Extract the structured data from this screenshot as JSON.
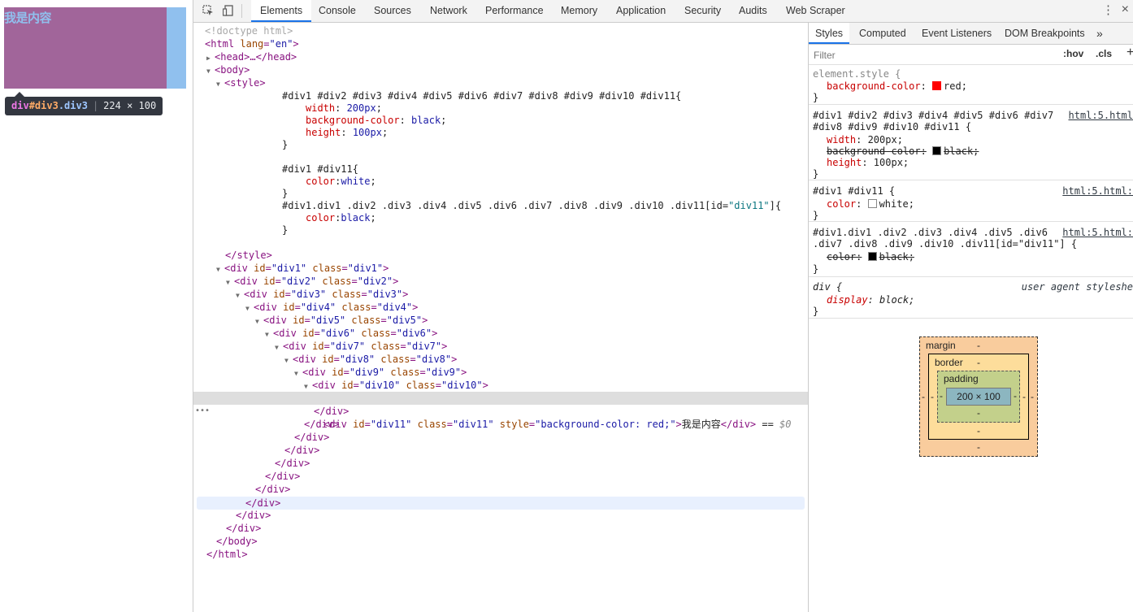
{
  "preview": {
    "content_text": "我是内容",
    "tooltip": {
      "tag": "div",
      "id": "#div3",
      "classes": ".div3",
      "size": "224 × 100"
    }
  },
  "toolbar": {
    "tabs": [
      "Elements",
      "Console",
      "Sources",
      "Network",
      "Performance",
      "Memory",
      "Application",
      "Security",
      "Audits",
      "Web Scraper"
    ],
    "active_tab": "Elements",
    "inspect_icon": "inspect-element-icon",
    "device_icon": "device-toolbar-icon",
    "menu_icon": "more-vertical-icon",
    "close_icon": "close-icon"
  },
  "dom": {
    "doctype": "<!doctype html>",
    "html_open_tag": "html",
    "html_lang_attr": "lang",
    "html_lang_val": "\"en\"",
    "head_collapsed": "<head>…</head>",
    "body_tag": "body",
    "style_tag": "style",
    "css_rule1_selector": "#div1 #div2 #div3 #div4 #div5 #div6 #div7 #div8 #div9 #div10 #div11{",
    "css_rule1_decls": [
      {
        "prop": "width",
        "val": "200px"
      },
      {
        "prop": "background-color",
        "val": "black"
      },
      {
        "prop": "height",
        "val": "100px"
      }
    ],
    "css_rule2_selector": "#div1 #div11{",
    "css_rule2_decls": [
      {
        "prop": "color",
        "val": "white"
      }
    ],
    "css_rule3_selector_pre": "#div1.div1 .div2 .div3 .div4 .div5 .div6 .div7 .div8 .div9 .div10 .div11[id=",
    "css_rule3_selector_str": "\"div11\"",
    "css_rule3_selector_post": "]{",
    "css_rule3_decls": [
      {
        "prop": "color",
        "val": "black"
      }
    ],
    "close_brace": "}",
    "style_close": "</style>",
    "divs": [
      {
        "id": "\"div1\"",
        "cls": "\"div1\""
      },
      {
        "id": "\"div2\"",
        "cls": "\"div2\""
      },
      {
        "id": "\"div3\"",
        "cls": "\"div3\""
      },
      {
        "id": "\"div4\"",
        "cls": "\"div4\""
      },
      {
        "id": "\"div5\"",
        "cls": "\"div5\""
      },
      {
        "id": "\"div6\"",
        "cls": "\"div6\""
      },
      {
        "id": "\"div7\"",
        "cls": "\"div7\""
      },
      {
        "id": "\"div8\"",
        "cls": "\"div8\""
      },
      {
        "id": "\"div9\"",
        "cls": "\"div9\""
      },
      {
        "id": "\"div10\"",
        "cls": "\"div10\""
      }
    ],
    "selected_node": {
      "id": "\"div11\"",
      "cls": "\"div11\"",
      "style": "\"background-color: red;\"",
      "text": "我是内容",
      "eq": "==",
      "var": "$0"
    },
    "div_close": "</div>",
    "body_close": "</body>",
    "html_close": "</html>"
  },
  "sidebar": {
    "tabs": [
      "Styles",
      "Computed",
      "Event Listeners",
      "DOM Breakpoints"
    ],
    "more_tabs_icon": "double-chevron-right-icon",
    "filter_placeholder": "Filter",
    "hov_label": ":hov",
    "cls_label": ".cls",
    "add_label": "+",
    "rules": {
      "element_style": {
        "selector": "element.style {",
        "prop": "background-color",
        "val": "red",
        "swatch": "#ff0000"
      },
      "rule1": {
        "selector_l1": "#div1 #div2 #div3 #div4 #div5 #div6 #div7",
        "selector_l2": "#div8 #div9 #div10 #div11 {",
        "source": "html:5.html",
        "decls": [
          "width: 200px;",
          "height: 100px;"
        ],
        "struck_prop": "background-color:",
        "struck_val": "black;",
        "swatch": "#000000"
      },
      "rule2": {
        "selector": "#div1 #div11 {",
        "source": "html:5.html:",
        "prop": "color",
        "val": "white;",
        "swatch": "#ffffff"
      },
      "rule3": {
        "selector_l1": "#div1.div1 .div2 .div3 .div4 .div5 .div6",
        "selector_l2": ".div7 .div8 .div9 .div10 .div11[id=\"div11\"] {",
        "source": "html:5.html:",
        "struck_prop": "color:",
        "struck_val": "black;",
        "swatch": "#000000"
      },
      "ua_rule": {
        "selector": "div {",
        "source": "user agent styleshe",
        "prop": "display",
        "val": "block;"
      },
      "close": "}"
    },
    "box_model": {
      "margin_label": "margin",
      "border_label": "border",
      "padding_label": "padding",
      "content_size": "200 × 100",
      "dash": "-"
    }
  }
}
